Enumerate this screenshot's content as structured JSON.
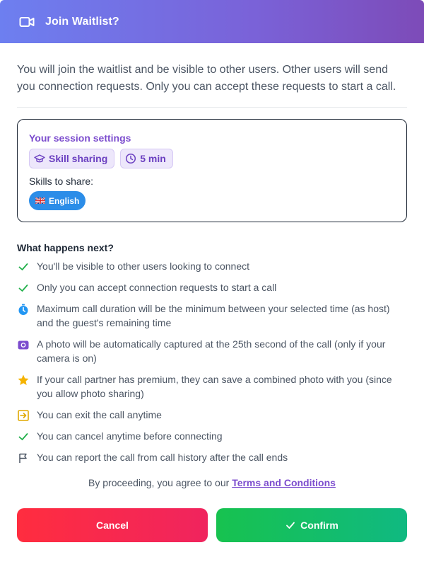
{
  "header": {
    "title": "Join Waitlist?",
    "icon": "video-camera-icon"
  },
  "intro": "You will join the waitlist and be visible to other users. Other users will send you connection requests. Only you can accept these requests to start a call.",
  "session": {
    "title": "Your session settings",
    "chips": [
      {
        "icon": "graduation-cap-icon",
        "label": "Skill sharing"
      },
      {
        "icon": "clock-icon",
        "label": "5 min"
      }
    ],
    "skills_label": "Skills to share:",
    "skills": [
      {
        "flag": "uk-flag-icon",
        "label": "English"
      }
    ]
  },
  "next": {
    "title": "What happens next?",
    "items": [
      {
        "icon": "check-icon",
        "text": "You'll be visible to other users looking to connect"
      },
      {
        "icon": "check-icon",
        "text": "Only you can accept connection requests to start a call"
      },
      {
        "icon": "stopwatch-icon",
        "text": "Maximum call duration will be the minimum between your selected time (as host) and the guest's remaining time"
      },
      {
        "icon": "camera-icon",
        "text": "A photo will be automatically captured at the 25th second of the call (only if your camera is on)"
      },
      {
        "icon": "star-icon",
        "text": "If your call partner has premium, they can save a combined photo with you (since you allow photo sharing)"
      },
      {
        "icon": "exit-icon",
        "text": "You can exit the call anytime"
      },
      {
        "icon": "check-icon",
        "text": "You can cancel anytime before connecting"
      },
      {
        "icon": "flag-icon",
        "text": "You can report the call from call history after the call ends"
      }
    ]
  },
  "agreement": {
    "prefix": "By proceeding, you agree to our ",
    "link": "Terms and Conditions"
  },
  "actions": {
    "cancel": "Cancel",
    "confirm": "Confirm"
  },
  "colors": {
    "accent": "#7c4dce",
    "cancel": "#ff2d3f",
    "confirm": "#17c24f",
    "skill": "#2b8de8"
  }
}
